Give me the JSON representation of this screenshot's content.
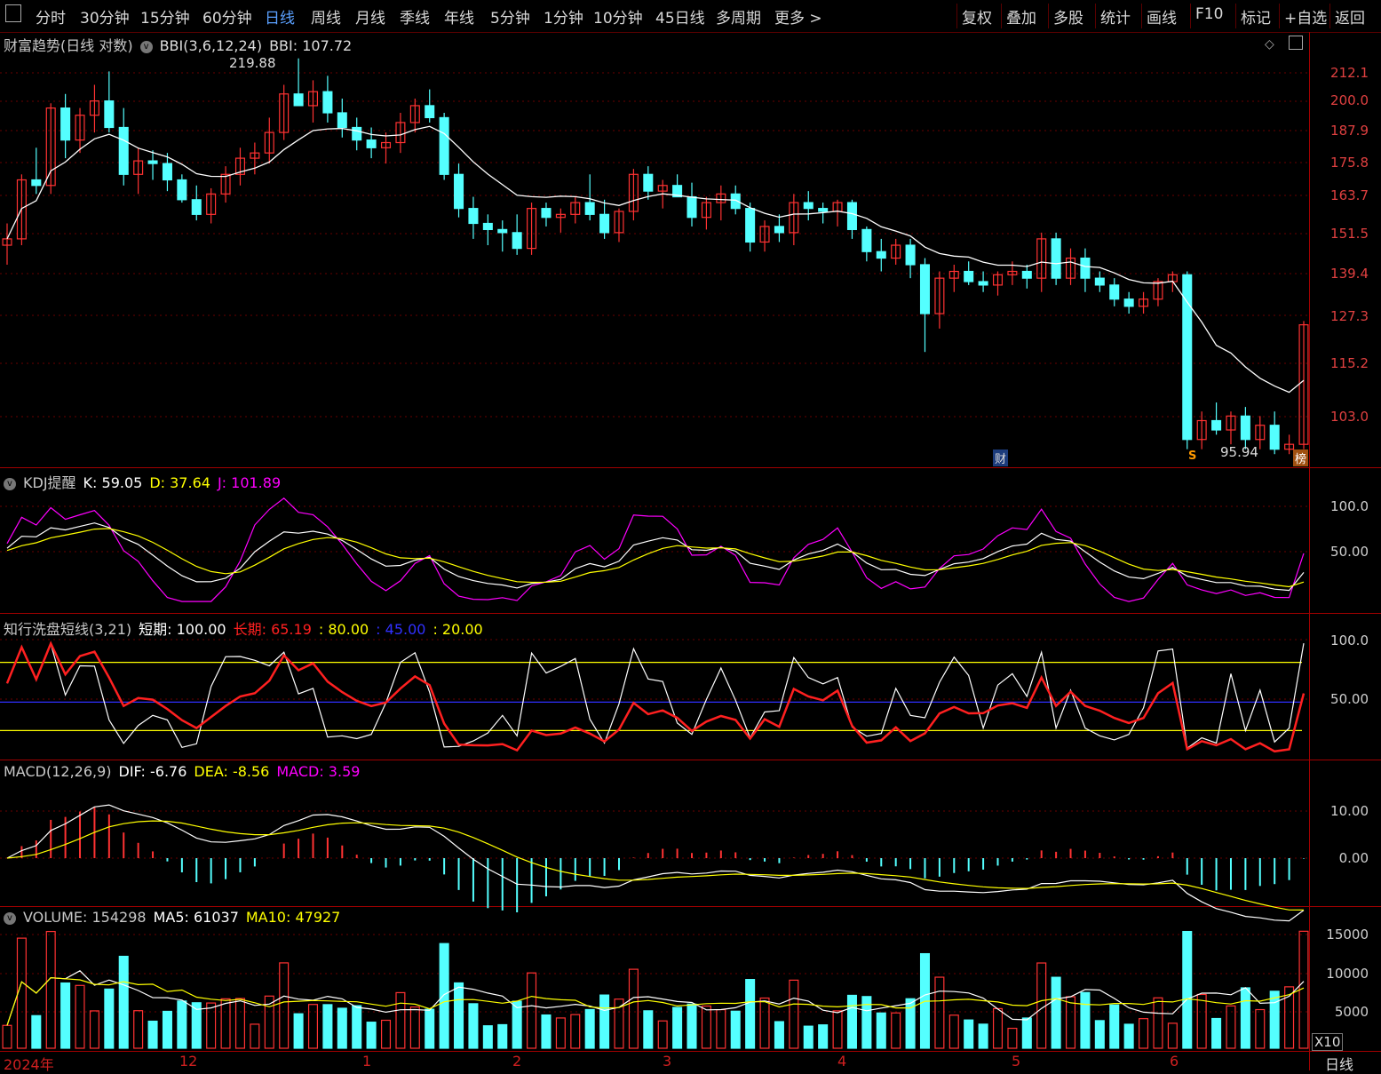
{
  "toolbar": {
    "left_items": [
      "分时",
      "30分钟",
      "15分钟",
      "60分钟",
      "日线",
      "周线",
      "月线",
      "季线",
      "年线",
      "5分钟",
      "1分钟",
      "10分钟",
      "45日线",
      "多周期",
      "更多 >"
    ],
    "active": "日线",
    "right_items": [
      "复权",
      "叠加",
      "多股",
      "统计",
      "画线",
      "F10",
      "标记",
      "+自选",
      "返回"
    ]
  },
  "main_panel": {
    "title": "财富趋势(日线 对数)",
    "indicator": "BBI(3,6,12,24)",
    "indicator_value": "BBI: 107.72",
    "high_label": "219.88",
    "low_label": "95.94",
    "y_ticks": [
      "212.1",
      "200.0",
      "187.9",
      "175.8",
      "163.7",
      "151.5",
      "139.4",
      "127.3",
      "115.2",
      "103.0"
    ],
    "badge_cai": "财",
    "badge_s": "S",
    "badge_bang": "榜"
  },
  "kdj_panel": {
    "title": "KDJ提醒",
    "k": "K: 59.05",
    "d": "D: 37.64",
    "j": "J: 101.89",
    "y_ticks": [
      "100.0",
      "50.00"
    ]
  },
  "wash_panel": {
    "title": "知行洗盘短线(3,21)",
    "short": "短期: 100.00",
    "long": "长期: 65.19",
    "l80": ": 80.00",
    "l45": ": 45.00",
    "l20": ": 20.00",
    "y_ticks": [
      "100.0",
      "50.00"
    ]
  },
  "macd_panel": {
    "title": "MACD(12,26,9)",
    "dif": "DIF: -6.76",
    "dea": "DEA: -8.56",
    "macd": "MACD: 3.59",
    "y_ticks": [
      "10.00",
      "0.00"
    ]
  },
  "volume_panel": {
    "title": "VOLUME: 154298",
    "ma5": "MA5: 61037",
    "ma10": "MA10: 47927",
    "y_ticks": [
      "15000",
      "10000",
      "5000"
    ],
    "unit": "X10"
  },
  "x_axis": {
    "labels": [
      "2024年",
      "12",
      "1",
      "2",
      "3",
      "4",
      "5",
      "6"
    ],
    "period": "日线"
  },
  "colors": {
    "up": "#ff3232",
    "down": "#54ffff",
    "grid": "#a00000",
    "k": "#ffffff",
    "d": "#ffff00",
    "j": "#ff00ff"
  },
  "chart_data": {
    "type": "candlestick",
    "ohlc": [
      [
        148,
        155,
        142,
        150
      ],
      [
        150,
        172,
        148,
        170
      ],
      [
        170,
        182,
        165,
        168
      ],
      [
        168,
        200,
        165,
        198
      ],
      [
        198,
        204,
        178,
        185
      ],
      [
        185,
        198,
        180,
        195
      ],
      [
        195,
        208,
        188,
        201
      ],
      [
        201,
        214,
        188,
        190
      ],
      [
        190,
        198,
        168,
        172
      ],
      [
        172,
        182,
        165,
        177
      ],
      [
        177,
        181,
        170,
        176
      ],
      [
        176,
        180,
        166,
        170
      ],
      [
        170,
        172,
        162,
        163
      ],
      [
        163,
        168,
        156,
        158
      ],
      [
        158,
        167,
        155,
        165
      ],
      [
        165,
        175,
        162,
        172
      ],
      [
        172,
        182,
        168,
        178
      ],
      [
        178,
        184,
        172,
        180
      ],
      [
        180,
        194,
        176,
        188
      ],
      [
        188,
        208,
        185,
        204
      ],
      [
        204,
        220,
        200,
        199
      ],
      [
        199,
        210,
        192,
        205
      ],
      [
        205,
        212,
        192,
        196
      ],
      [
        196,
        202,
        186,
        190
      ],
      [
        190,
        194,
        181,
        185
      ],
      [
        185,
        190,
        178,
        182
      ],
      [
        182,
        188,
        176,
        184
      ],
      [
        184,
        196,
        180,
        192
      ],
      [
        192,
        202,
        188,
        199
      ],
      [
        199,
        206,
        192,
        194
      ],
      [
        194,
        196,
        170,
        172
      ],
      [
        172,
        176,
        157,
        160
      ],
      [
        160,
        164,
        150,
        155
      ],
      [
        155,
        158,
        148,
        153
      ],
      [
        153,
        156,
        146,
        152
      ],
      [
        152,
        158,
        145,
        147
      ],
      [
        147,
        162,
        145,
        160
      ],
      [
        160,
        162,
        154,
        157
      ],
      [
        157,
        160,
        152,
        158
      ],
      [
        158,
        164,
        155,
        162
      ],
      [
        162,
        172,
        156,
        158
      ],
      [
        158,
        163,
        150,
        152
      ],
      [
        152,
        160,
        149,
        159
      ],
      [
        159,
        174,
        156,
        172
      ],
      [
        172,
        175,
        163,
        166
      ],
      [
        166,
        170,
        160,
        168
      ],
      [
        168,
        172,
        164,
        164
      ],
      [
        164,
        169,
        154,
        157
      ],
      [
        157,
        164,
        153,
        162
      ],
      [
        162,
        168,
        156,
        165
      ],
      [
        165,
        168,
        158,
        160
      ],
      [
        160,
        162,
        146,
        149
      ],
      [
        149,
        156,
        146,
        154
      ],
      [
        154,
        158,
        149,
        152
      ],
      [
        152,
        165,
        148,
        162
      ],
      [
        162,
        166,
        156,
        160
      ],
      [
        160,
        162,
        155,
        159
      ],
      [
        159,
        163,
        154,
        162
      ],
      [
        162,
        163,
        150,
        153
      ],
      [
        153,
        154,
        143,
        146
      ],
      [
        146,
        150,
        140,
        144
      ],
      [
        144,
        150,
        142,
        148
      ],
      [
        148,
        150,
        138,
        142
      ],
      [
        142,
        144,
        118,
        128
      ],
      [
        128,
        140,
        124,
        138
      ],
      [
        138,
        142,
        134,
        140
      ],
      [
        140,
        143,
        136,
        137
      ],
      [
        137,
        140,
        134,
        136
      ],
      [
        136,
        140,
        133,
        139
      ],
      [
        139,
        143,
        136,
        140
      ],
      [
        140,
        142,
        135,
        138
      ],
      [
        138,
        152,
        134,
        150
      ],
      [
        150,
        152,
        136,
        138
      ],
      [
        138,
        147,
        136,
        144
      ],
      [
        144,
        147,
        134,
        138
      ],
      [
        138,
        140,
        134,
        136
      ],
      [
        136,
        138,
        130,
        132
      ],
      [
        132,
        134,
        128,
        130
      ],
      [
        130,
        134,
        128,
        132
      ],
      [
        132,
        138,
        130,
        137
      ],
      [
        137,
        140,
        134,
        139
      ],
      [
        139,
        140,
        96,
        98
      ],
      [
        98,
        104,
        96,
        102
      ],
      [
        102,
        106,
        99,
        100
      ],
      [
        100,
        104,
        97,
        103
      ],
      [
        103,
        105,
        96,
        98
      ],
      [
        98,
        103,
        96,
        101
      ],
      [
        101,
        104,
        95,
        96
      ],
      [
        96,
        99,
        95,
        97
      ],
      [
        97,
        126,
        96,
        125
      ]
    ]
  }
}
